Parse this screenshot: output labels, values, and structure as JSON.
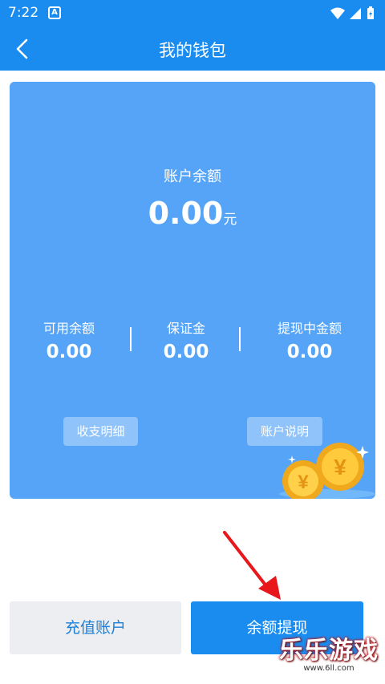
{
  "status_bar": {
    "time": "7:22",
    "app_badge": "A"
  },
  "header": {
    "title": "我的钱包"
  },
  "wallet": {
    "balance_label": "账户余额",
    "balance_value": "0.00",
    "balance_unit": "元",
    "stats": [
      {
        "label": "可用余额",
        "value": "0.00"
      },
      {
        "label": "保证金",
        "value": "0.00"
      },
      {
        "label": "提现中金额",
        "value": "0.00"
      }
    ],
    "details_button": "收支明细",
    "explain_button": "账户说明"
  },
  "actions": {
    "recharge": "充值账户",
    "withdraw": "余额提现"
  },
  "watermark": {
    "main": "乐乐游戏",
    "sub": "www.6ll.com"
  },
  "colors": {
    "primary": "#1a8cf0",
    "card": "#55a4f8",
    "arrow": "#e8171b"
  }
}
